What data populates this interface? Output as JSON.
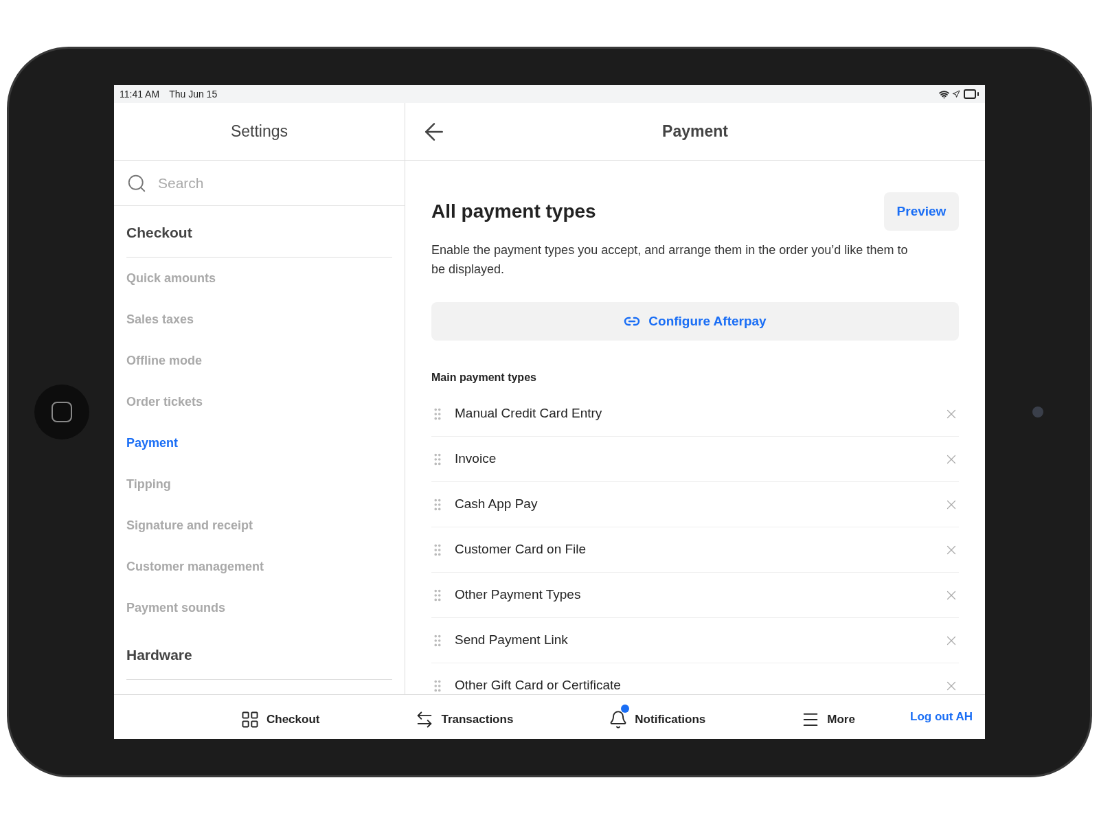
{
  "status_bar": {
    "time": "11:41 AM",
    "date": "Thu Jun 15"
  },
  "sidebar": {
    "title": "Settings",
    "search": {
      "placeholder": "Search"
    },
    "sections": [
      {
        "title": "Checkout",
        "items": [
          {
            "label": "Quick amounts",
            "selected": false
          },
          {
            "label": "Sales taxes",
            "selected": false
          },
          {
            "label": "Offline mode",
            "selected": false
          },
          {
            "label": "Order tickets",
            "selected": false
          },
          {
            "label": "Payment",
            "selected": true
          },
          {
            "label": "Tipping",
            "selected": false
          },
          {
            "label": "Signature and receipt",
            "selected": false
          },
          {
            "label": "Customer management",
            "selected": false
          },
          {
            "label": "Payment sounds",
            "selected": false
          }
        ]
      },
      {
        "title": "Hardware"
      }
    ]
  },
  "detail": {
    "title": "Payment",
    "heading": "All payment types",
    "preview_button": "Preview",
    "description": "Enable the payment types you accept, and arrange them in the order you’d like them to be displayed.",
    "configure_button": "Configure Afterpay",
    "section_title": "Main payment types",
    "payment_types": [
      "Manual Credit Card Entry",
      "Invoice",
      "Cash App Pay",
      "Customer Card on File",
      "Other Payment Types",
      "Send Payment Link",
      "Other Gift Card or Certificate"
    ]
  },
  "bottom_nav": {
    "items": [
      {
        "kind": "checkout",
        "label": "Checkout",
        "unread": false
      },
      {
        "kind": "transactions",
        "label": "Transactions",
        "unread": false
      },
      {
        "kind": "notifications",
        "label": "Notifications",
        "unread": true
      },
      {
        "kind": "more",
        "label": "More",
        "unread": false
      }
    ],
    "logout": "Log out AH"
  }
}
